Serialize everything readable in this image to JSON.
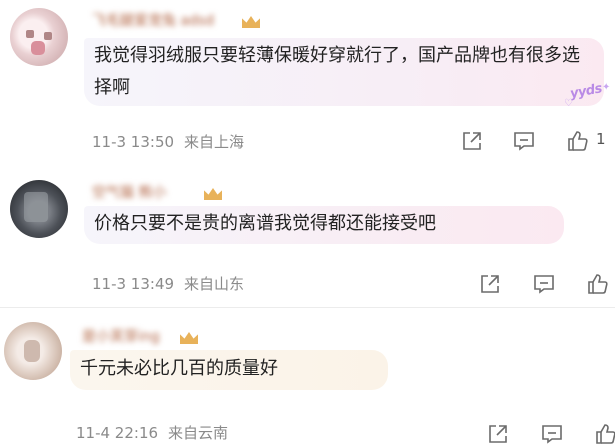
{
  "comments": [
    {
      "username": "飞毛腿爱宠兔 adsd",
      "text": "我觉得羽绒服只要轻薄保暖好穿就行了，国产品牌也有很多选择啊",
      "sticker": "yyds",
      "time": "11-3 13:50",
      "location": "来自上海",
      "like_count": "1"
    },
    {
      "username": "空气猫 熊小",
      "text": "价格只要不是贵的离谱我觉得都还能接受吧",
      "time": "11-3 13:49",
      "location": "来自山东"
    },
    {
      "username": "是小芙芽ing",
      "text": "千元未必比几百的质量好",
      "time": "11-4 22:16",
      "location": "来自云南"
    }
  ],
  "icons": {
    "share": "share-icon",
    "comment": "comment-icon",
    "like": "thumbs-up-icon",
    "badge": "crown-badge-icon"
  },
  "colors": {
    "meta_text": "#8a8a8a",
    "body_text": "#222222",
    "sticker": "#b98ae6",
    "crown": "#e8b25a"
  }
}
